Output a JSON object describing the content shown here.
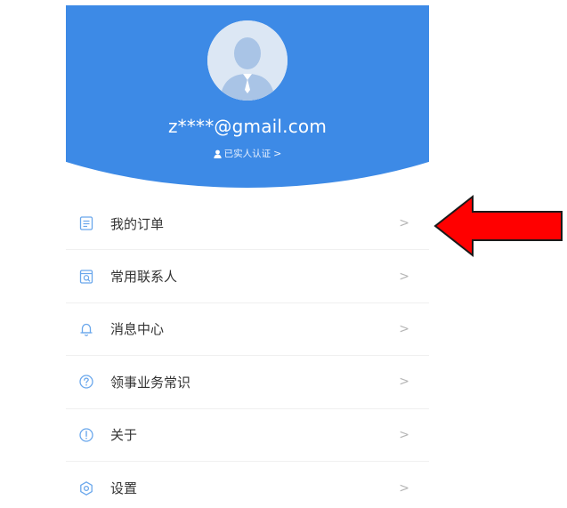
{
  "profile": {
    "account": "z****@gmail.com",
    "verify_label": "已实人认证",
    "verify_chevron": ">"
  },
  "menu": {
    "items": [
      {
        "label": "我的订单",
        "icon": "order-icon"
      },
      {
        "label": "常用联系人",
        "icon": "contacts-icon"
      },
      {
        "label": "消息中心",
        "icon": "bell-icon"
      },
      {
        "label": "领事业务常识",
        "icon": "help-icon"
      },
      {
        "label": "关于",
        "icon": "info-icon"
      },
      {
        "label": "设置",
        "icon": "settings-icon"
      }
    ],
    "chevron": ">"
  },
  "colors": {
    "header_blue": "#3d8ae6",
    "icon_blue": "#6aa7ec",
    "arrow_red": "#ff0000"
  }
}
